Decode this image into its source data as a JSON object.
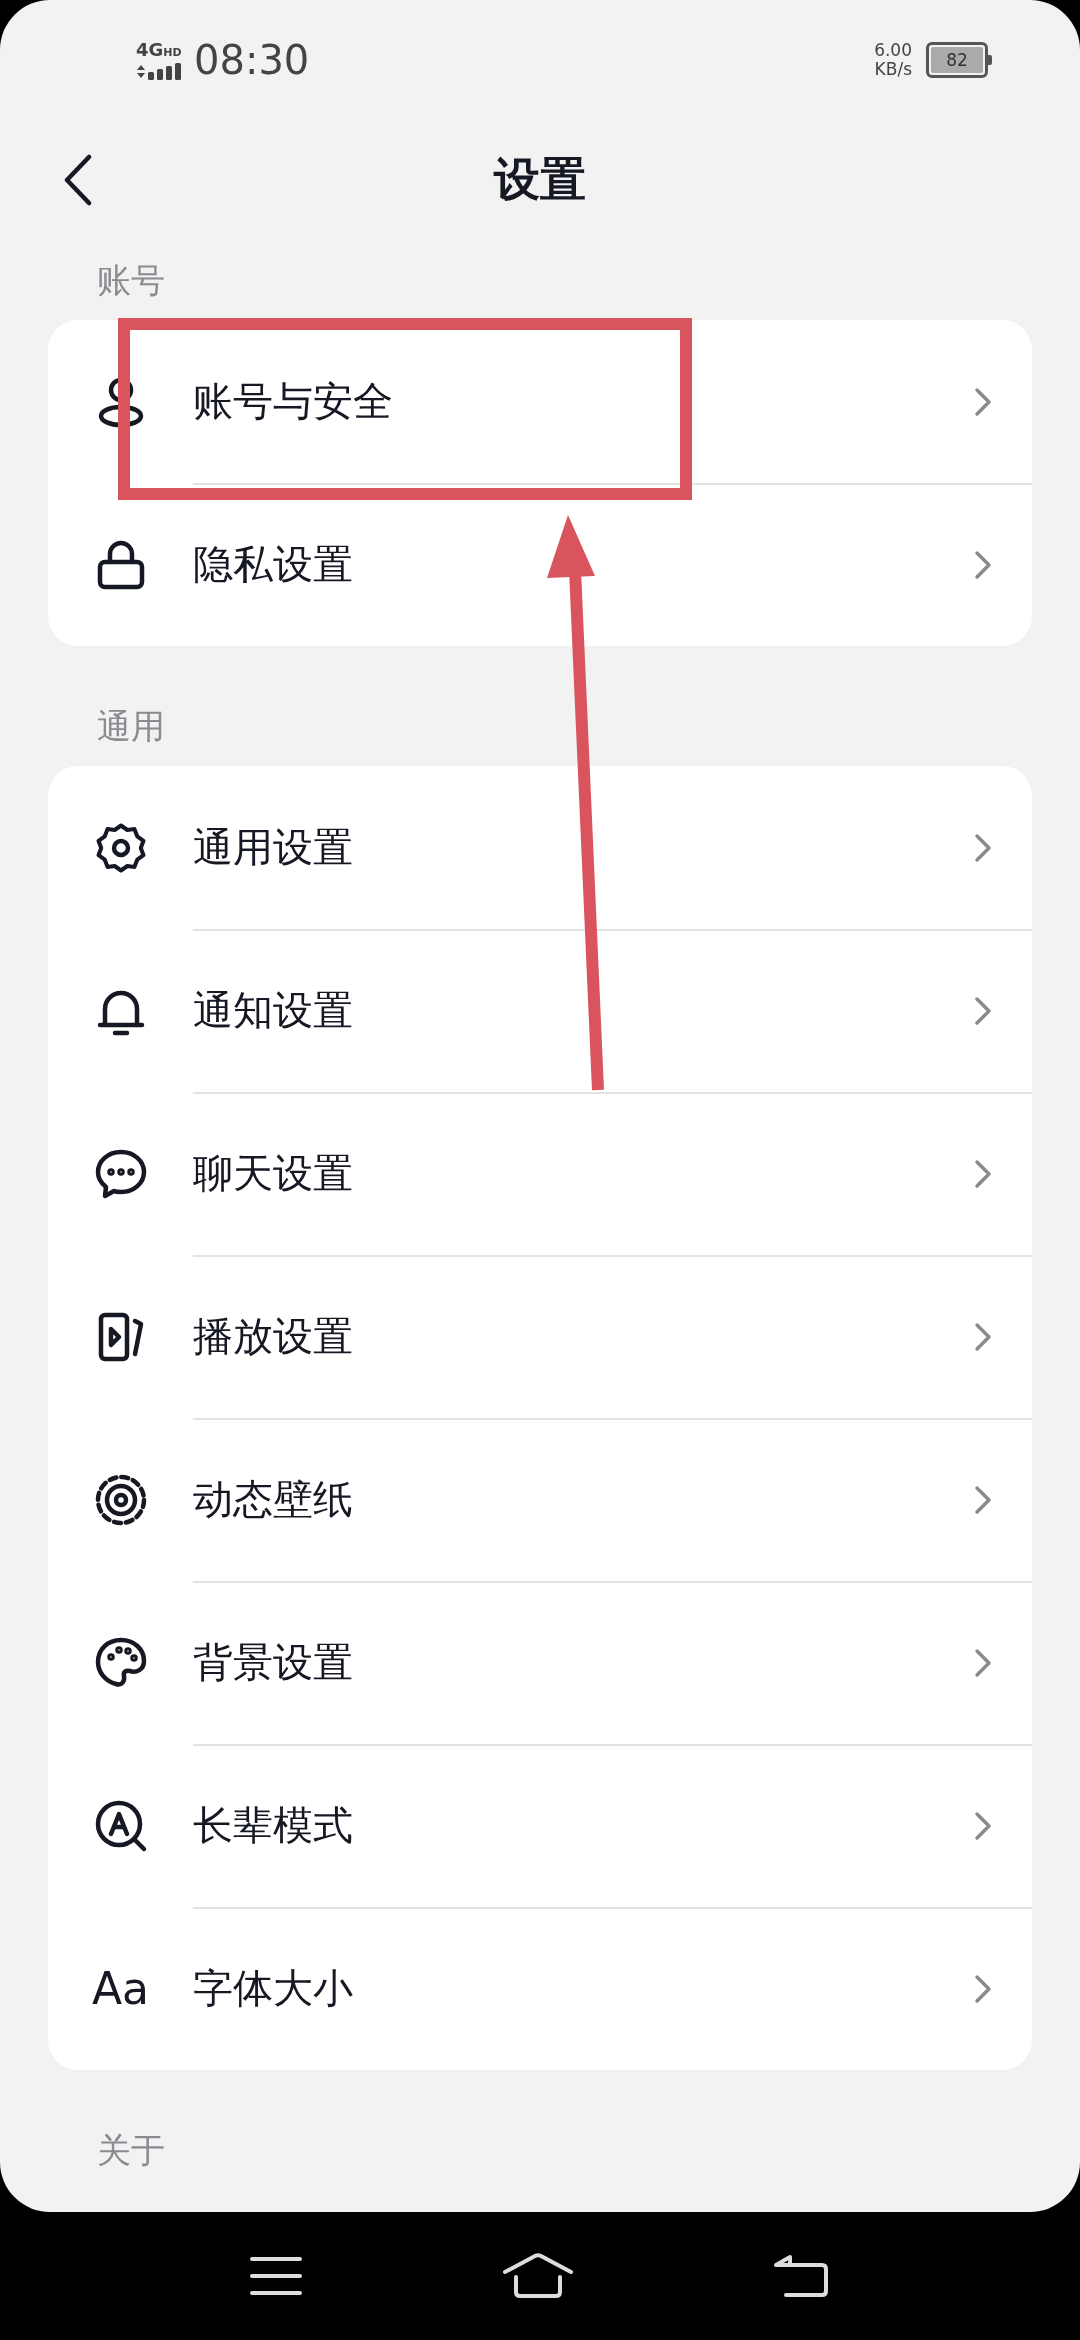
{
  "status_bar": {
    "network": "4G",
    "network_badge": "HD",
    "time": "08:30",
    "speed_value": "6.00",
    "speed_unit": "KB/s",
    "battery": "82"
  },
  "header": {
    "title": "设置"
  },
  "sections": [
    {
      "title": "账号",
      "items": [
        {
          "kind": "account",
          "label": "账号与安全"
        },
        {
          "kind": "privacy",
          "label": "隐私设置"
        }
      ]
    },
    {
      "title": "通用",
      "items": [
        {
          "kind": "general",
          "label": "通用设置"
        },
        {
          "kind": "notification",
          "label": "通知设置"
        },
        {
          "kind": "chat",
          "label": "聊天设置"
        },
        {
          "kind": "playback",
          "label": "播放设置"
        },
        {
          "kind": "wallpaper",
          "label": "动态壁纸"
        },
        {
          "kind": "background",
          "label": "背景设置"
        },
        {
          "kind": "elder",
          "label": "长辈模式"
        },
        {
          "kind": "font",
          "icon_text": "Aa",
          "label": "字体大小"
        }
      ]
    },
    {
      "title": "关于"
    }
  ]
}
